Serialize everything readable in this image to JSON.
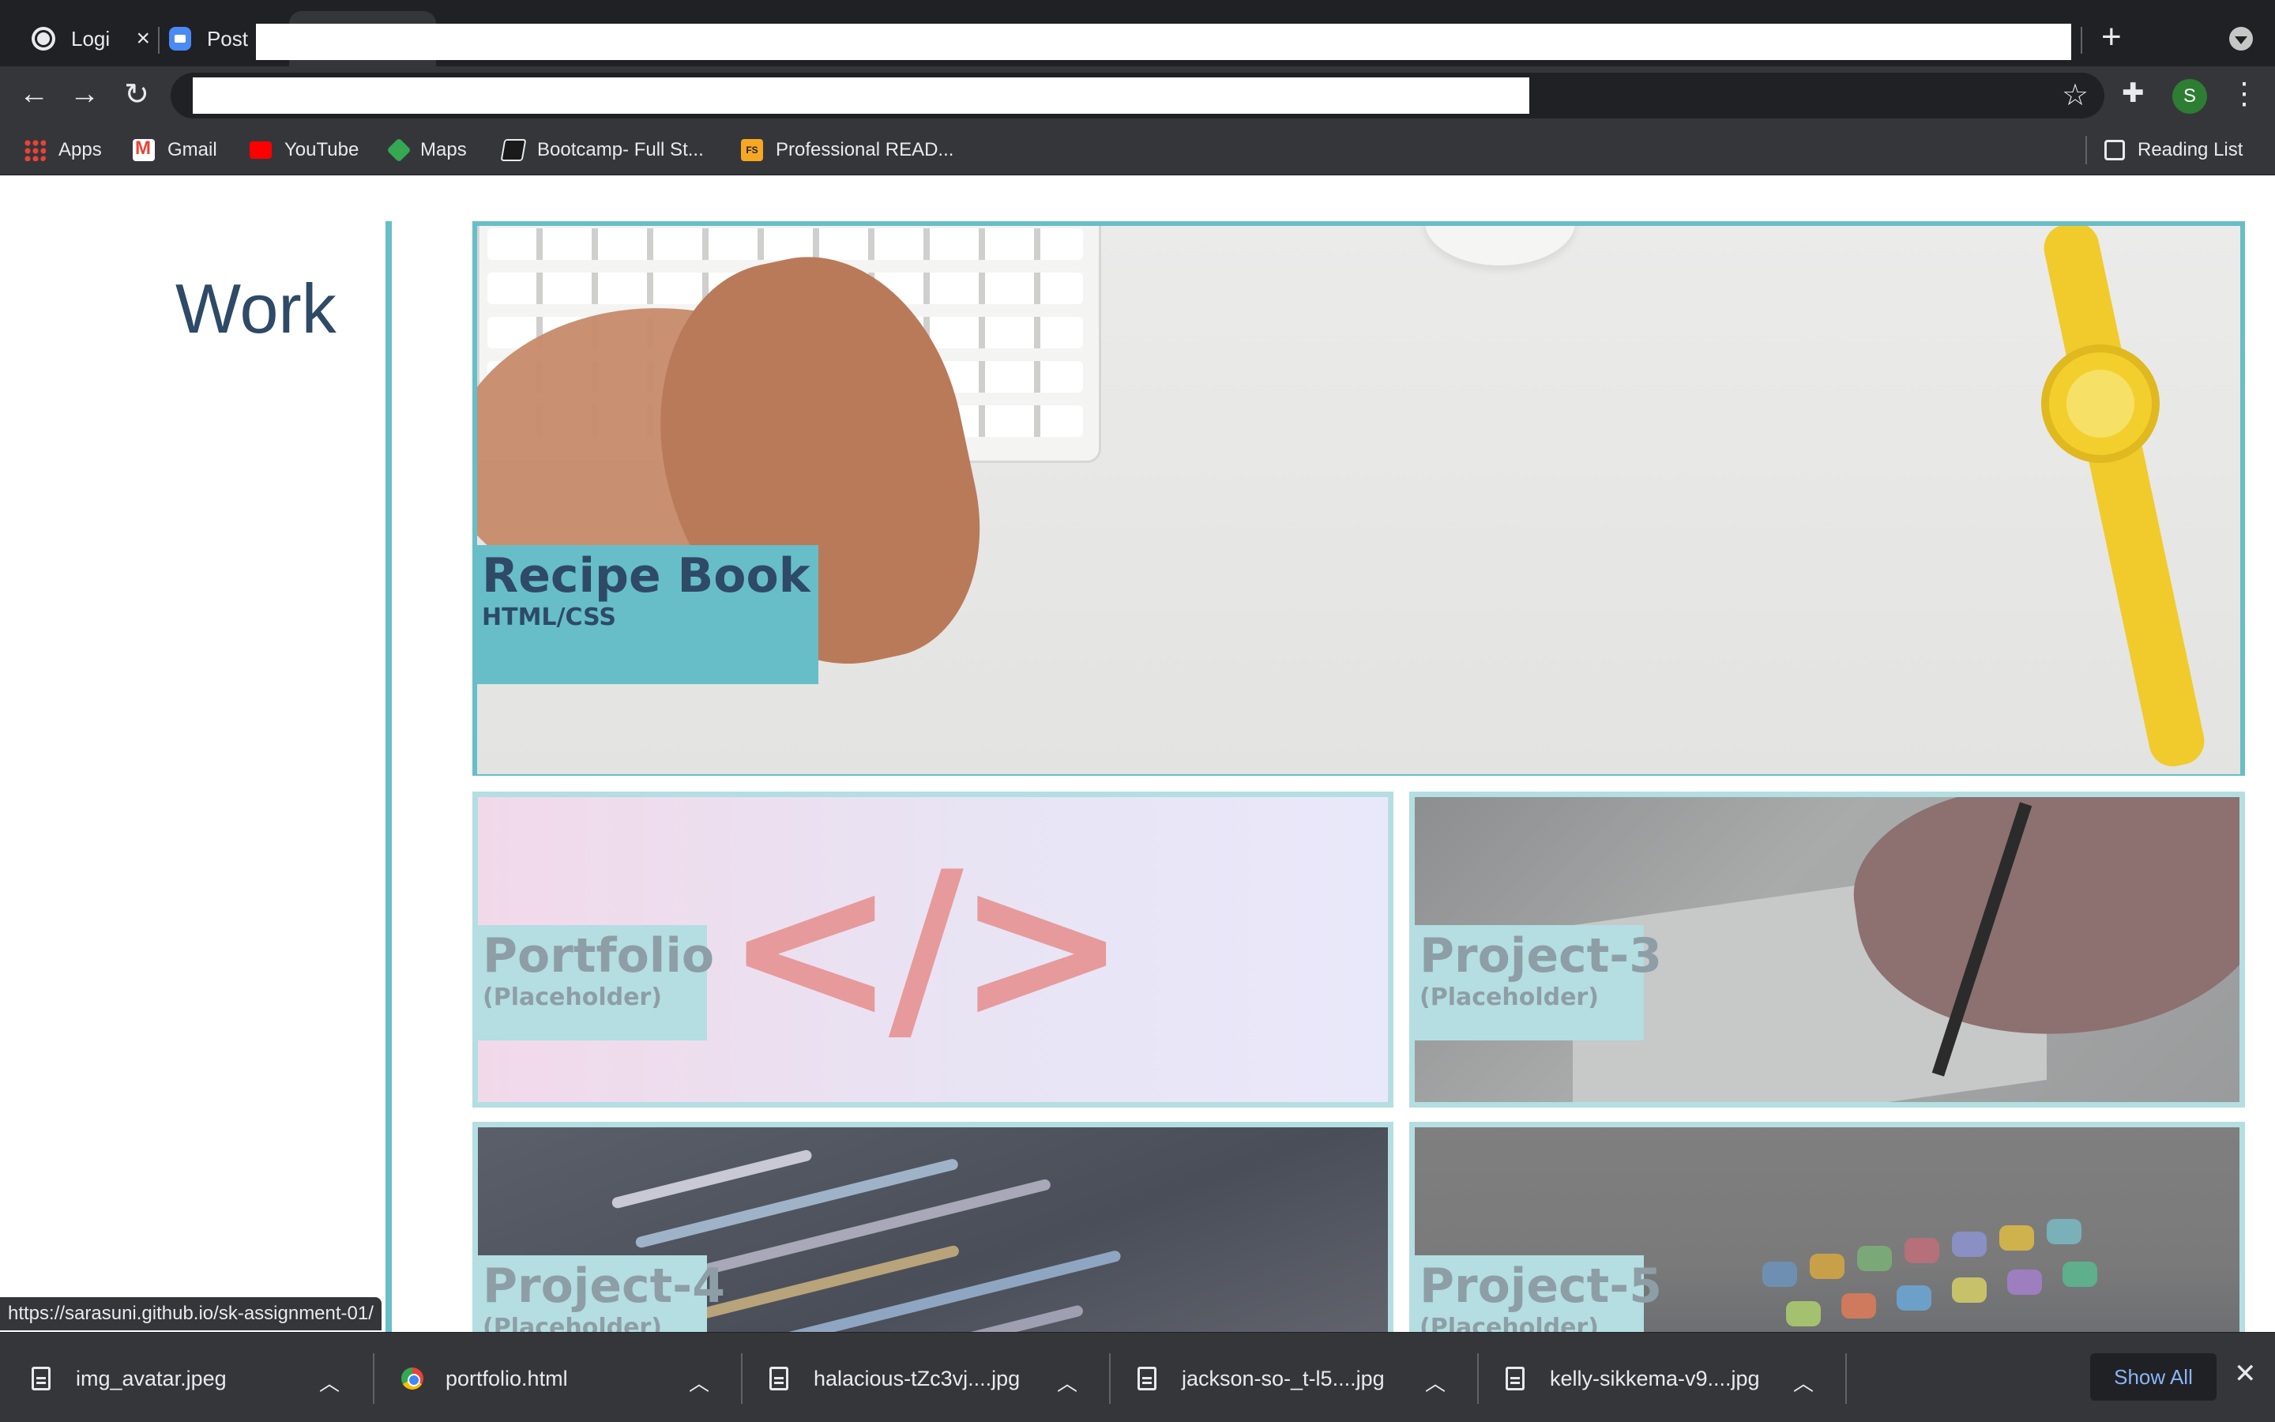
{
  "browser": {
    "tabs": [
      {
        "title": "Logi"
      },
      {
        "title": "Post"
      }
    ],
    "new_tab_label": "+",
    "profile_initial": "S",
    "bookmarks": [
      {
        "label": "Apps",
        "icon": "apps-grid-icon"
      },
      {
        "label": "Gmail",
        "icon": "gmail-icon"
      },
      {
        "label": "YouTube",
        "icon": "youtube-icon"
      },
      {
        "label": "Maps",
        "icon": "maps-pin-icon"
      },
      {
        "label": "Bootcamp- Full St...",
        "icon": "bootcamp-icon"
      },
      {
        "label": "Professional READ...",
        "icon": "fs-icon"
      }
    ],
    "reading_list_label": "Reading List"
  },
  "page": {
    "section_title": "Work",
    "accent_color": "#67bec8",
    "title_color": "#2e4a66",
    "projects": [
      {
        "title": "Recipe Book",
        "subtitle": "HTML/CSS"
      },
      {
        "title": "Portfolio",
        "subtitle": "(Placeholder)"
      },
      {
        "title": "Project-3",
        "subtitle": "(Placeholder)"
      },
      {
        "title": "Project-4",
        "subtitle": "(Placeholder)"
      },
      {
        "title": "Project-5",
        "subtitle": "(Placeholder)"
      }
    ],
    "code_glyph": "</>"
  },
  "status_url": "https://sarasuni.github.io/sk-assignment-01/",
  "downloads": {
    "items": [
      {
        "name": "img_avatar.jpeg",
        "icon": "file-icon"
      },
      {
        "name": "portfolio.html",
        "icon": "chrome-icon"
      },
      {
        "name": "halacious-tZc3vj....jpg",
        "icon": "file-icon"
      },
      {
        "name": "jackson-so-_t-l5....jpg",
        "icon": "file-icon"
      },
      {
        "name": "kelly-sikkema-v9....jpg",
        "icon": "file-icon"
      }
    ],
    "show_all_label": "Show All"
  }
}
